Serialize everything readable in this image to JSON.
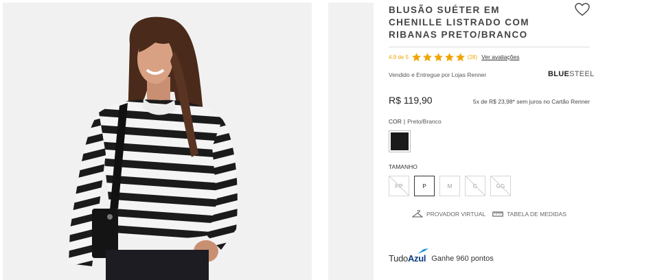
{
  "product": {
    "title": "BLUSÃO SUÉTER EM CHENILLE LISTRADO COM RIBANAS PRETO/BRANCO",
    "rating": "4.9 de 5",
    "rating_value": 4.9,
    "rating_max": 5,
    "review_count": "(28)",
    "reviews_link": "Ver avaliações",
    "seller": "Vendido e Entregue por Lojas Renner",
    "brand_bold": "BLUE",
    "brand_thin": "STEEL",
    "price": "R$ 119,90",
    "installments": "5x de R$ 23,98* sem juros no Cartão Renner",
    "color_label": "COR",
    "color_value": "Preto/Branco",
    "color_swatch": "#1a1a1a",
    "size_label": "TAMANHO",
    "sizes": [
      {
        "label": "PP",
        "available": false
      },
      {
        "label": "P",
        "available": true
      },
      {
        "label": "M",
        "available": true
      },
      {
        "label": "G",
        "available": false
      },
      {
        "label": "GG",
        "available": false
      }
    ],
    "selected_size": "P",
    "virtual_fitting": "PROVADOR VIRTUAL",
    "size_chart": "TABELA DE MEDIDAS",
    "points_logo_a": "Tudo",
    "points_logo_b": "Azul",
    "points_text": "Ganhe 960 pontos"
  },
  "icons": {
    "favorite": "heart-icon",
    "star": "star-icon",
    "fitting": "hanger-icon",
    "measure": "ruler-icon"
  },
  "colors": {
    "star": "#f0a500",
    "brand_blue": "#0b3c7d"
  }
}
